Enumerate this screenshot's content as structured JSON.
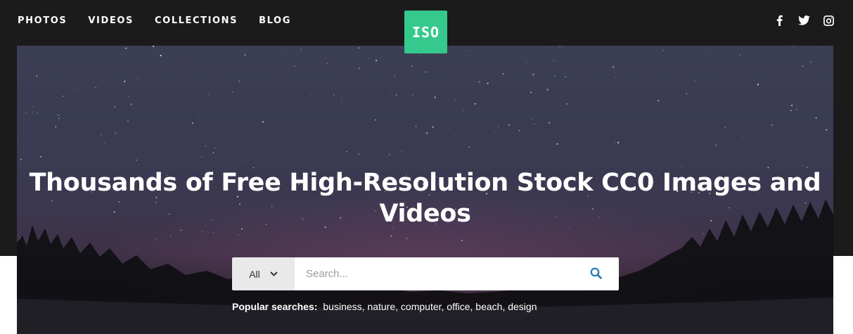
{
  "nav": {
    "items": [
      {
        "label": "PHOTOS"
      },
      {
        "label": "VIDEOS"
      },
      {
        "label": "COLLECTIONS"
      },
      {
        "label": "BLOG"
      }
    ]
  },
  "logo": {
    "text": "ISO",
    "color": "#35c98e"
  },
  "social": {
    "icons": [
      "facebook-icon",
      "twitter-icon",
      "instagram-icon"
    ]
  },
  "hero": {
    "headline": "Thousands of Free High-Resolution Stock CC0 Images and Videos"
  },
  "search": {
    "filter_label": "All",
    "placeholder": "Search...",
    "accent": "#2f7fb6"
  },
  "popular": {
    "label": "Popular searches:",
    "terms": [
      "business",
      "nature",
      "computer",
      "office",
      "beach",
      "design"
    ]
  }
}
